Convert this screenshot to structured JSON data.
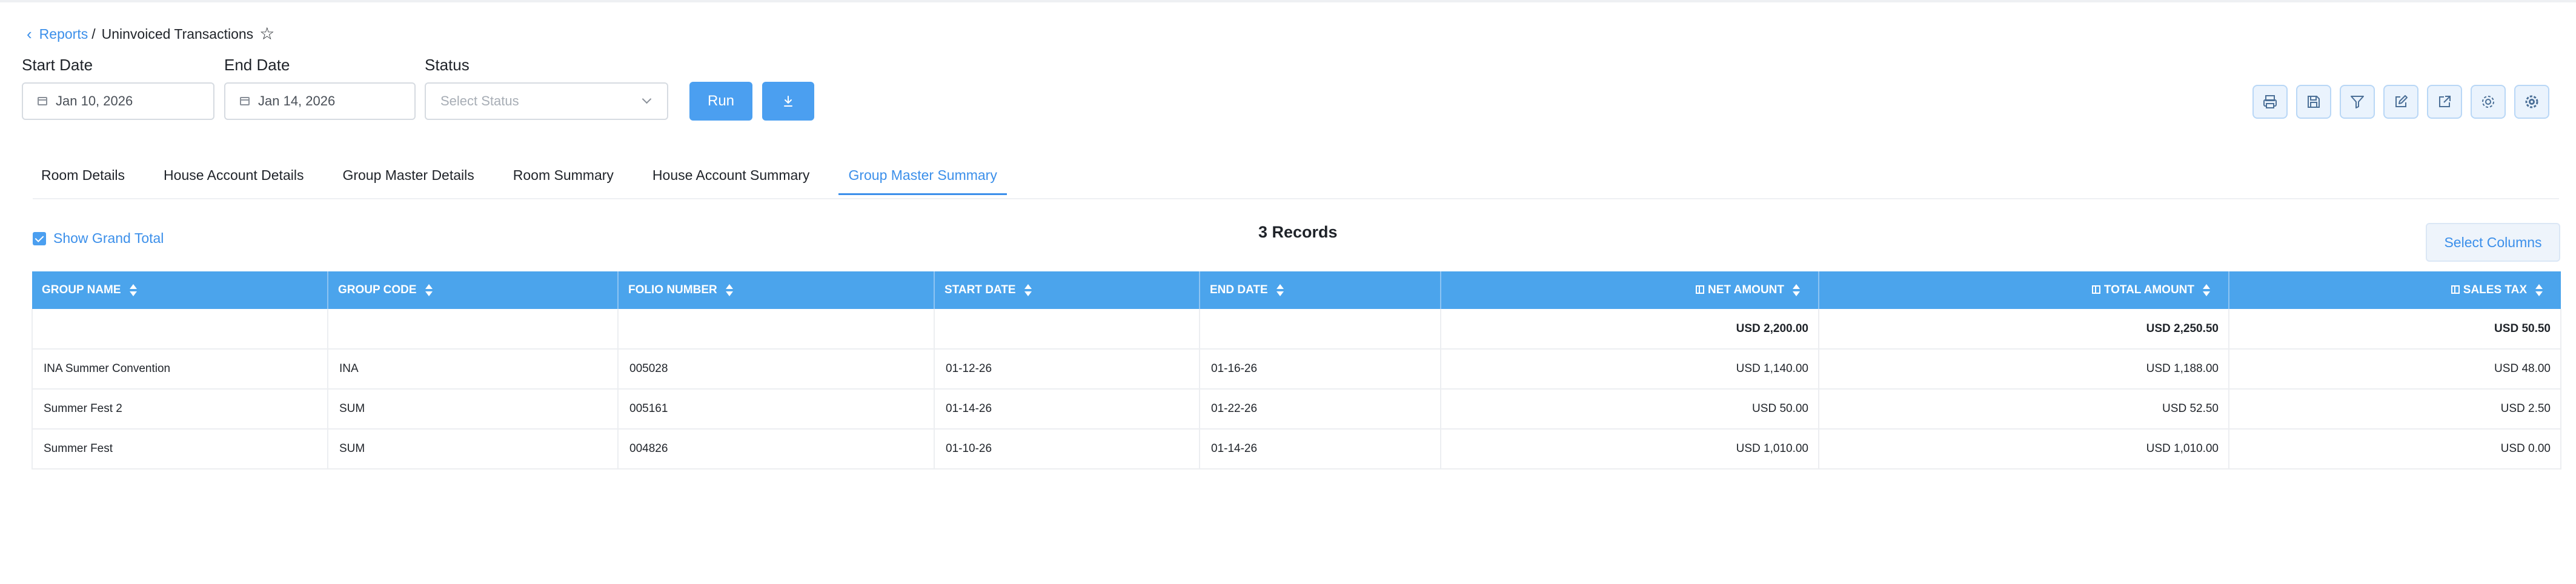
{
  "breadcrumb": {
    "back_icon": "chevron-left-icon",
    "parent": "Reports",
    "separator": "/",
    "current": "Uninvoiced Transactions",
    "favorite_icon": "star-icon"
  },
  "filters": {
    "start_date": {
      "label": "Start Date",
      "value": "Jan 10, 2026"
    },
    "end_date": {
      "label": "End Date",
      "value": "Jan 14, 2026"
    },
    "status": {
      "label": "Status",
      "placeholder": "Select Status"
    },
    "run_label": "Run",
    "download_icon": "download-icon"
  },
  "toolbar": [
    "print-icon",
    "save-icon",
    "filter-icon",
    "edit-icon",
    "export-icon",
    "settings-icon",
    "advanced-settings-icon"
  ],
  "tabs": [
    "Room Details",
    "House Account Details",
    "Group Master Details",
    "Room Summary",
    "House Account Summary",
    "Group Master Summary"
  ],
  "active_tab": "Group Master Summary",
  "grand_total": {
    "label": "Show Grand Total",
    "checked": true
  },
  "records": "3 Records",
  "select_columns": "Select Columns",
  "table": {
    "columns": [
      "GROUP NAME",
      "GROUP CODE",
      "FOLIO NUMBER",
      "START DATE",
      "END DATE",
      "NET AMOUNT",
      "TOTAL AMOUNT",
      "SALES TAX"
    ],
    "totals": {
      "net": "USD 2,200.00",
      "total": "USD 2,250.50",
      "tax": "USD 50.50"
    },
    "rows": [
      [
        "INA Summer Convention",
        "INA",
        "005028",
        "01-12-26",
        "01-16-26",
        "USD 1,140.00",
        "USD 1,188.00",
        "USD 48.00"
      ],
      [
        "Summer Fest 2",
        "SUM",
        "005161",
        "01-14-26",
        "01-22-26",
        "USD 50.00",
        "USD 52.50",
        "USD 2.50"
      ],
      [
        "Summer Fest",
        "SUM",
        "004826",
        "01-10-26",
        "01-14-26",
        "USD 1,010.00",
        "USD 1,010.00",
        "USD 0.00"
      ]
    ]
  },
  "colors": {
    "accent": "#3b8fea",
    "header_bg": "#4ba4ec",
    "button_bg": "#4b9ff0"
  }
}
